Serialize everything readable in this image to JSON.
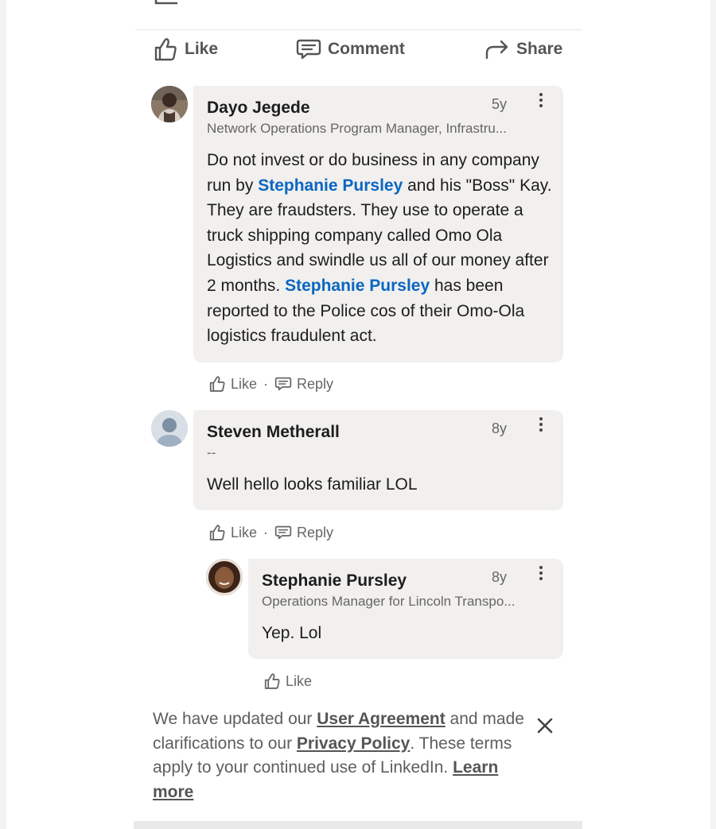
{
  "post_actions": {
    "like": "Like",
    "comment": "Comment",
    "share": "Share"
  },
  "comments": [
    {
      "author": "Dayo Jegede",
      "headline": "Network Operations Program Manager, Infrastru...",
      "time": "5y",
      "body": {
        "p1": "Do not invest or do business in any company run by ",
        "m1": "Stephanie Pursley",
        "p2": " and his \"Boss\" Kay. They are fraudsters. They use to operate a truck shipping company called Omo Ola Logistics and swindle us all of our money after 2 months. ",
        "m2": "Stephanie Pursley",
        "p3": " has been reported to the Police cos of their Omo-Ola logistics fraudulent act."
      },
      "like": "Like",
      "reply": "Reply"
    },
    {
      "author": "Steven Metherall",
      "headline": "--",
      "time": "8y",
      "body": "Well hello looks familiar LOL",
      "like": "Like",
      "reply": "Reply"
    }
  ],
  "reply": {
    "author": "Stephanie Pursley",
    "headline": "Operations Manager for Lincoln Transpo...",
    "time": "8y",
    "body": "Yep. Lol",
    "like": "Like"
  },
  "notice": {
    "t1": "We have updated our ",
    "link1": "User Agreement",
    "t2": " and made clarifications to our ",
    "link2": "Privacy Policy",
    "t3": ". These terms apply to your continued use of LinkedIn. ",
    "link3": "Learn more"
  },
  "icons": {
    "back": "arrow-left-icon",
    "like": "thumbs-up-icon",
    "comment": "comment-icon",
    "share": "share-arrow-icon",
    "reply": "reply-bubble-icon",
    "more": "more-vertical-icon",
    "close": "close-icon"
  },
  "colors": {
    "mention": "#0a66c2",
    "bubble": "#f1f0ee",
    "muted_text": "#666666"
  }
}
